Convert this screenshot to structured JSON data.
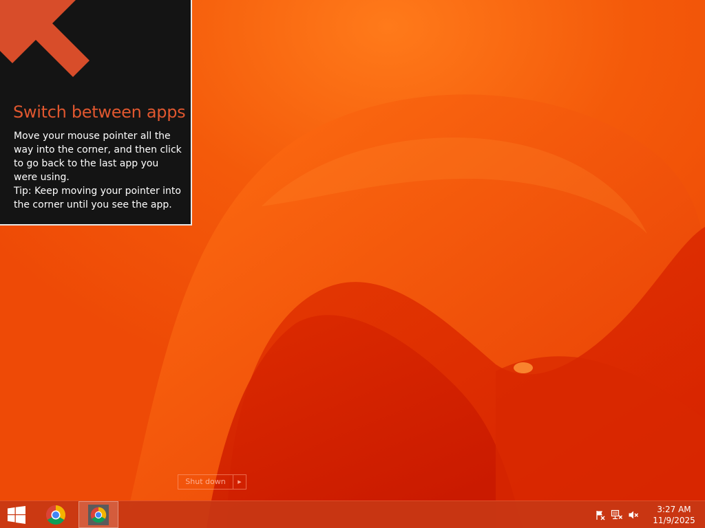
{
  "tip": {
    "title": "Switch between apps",
    "body_line1": "Move your mouse pointer all the way into the corner, and then click to go back to the last app you were using.",
    "body_line2": "Tip: Keep moving your pointer into the corner until you see the app."
  },
  "shutdown": {
    "label": "Shut down",
    "arrow": "▶"
  },
  "taskbar": {
    "start_icon": "windows-logo-icon",
    "apps": [
      {
        "name": "Google Chrome",
        "icon": "chrome-icon",
        "state": "pinned"
      },
      {
        "name": "Google Chrome",
        "icon": "chrome-icon",
        "state": "running"
      }
    ],
    "tray": {
      "icons": [
        "action-center-flag-icon",
        "network-icon",
        "volume-muted-icon"
      ]
    },
    "clock": {
      "time": "3:27 AM",
      "date": "11/9/2025"
    }
  },
  "colors": {
    "accent": "#e0572f",
    "wallpaper_base": "#f04a08",
    "tip_background": "#141414"
  }
}
